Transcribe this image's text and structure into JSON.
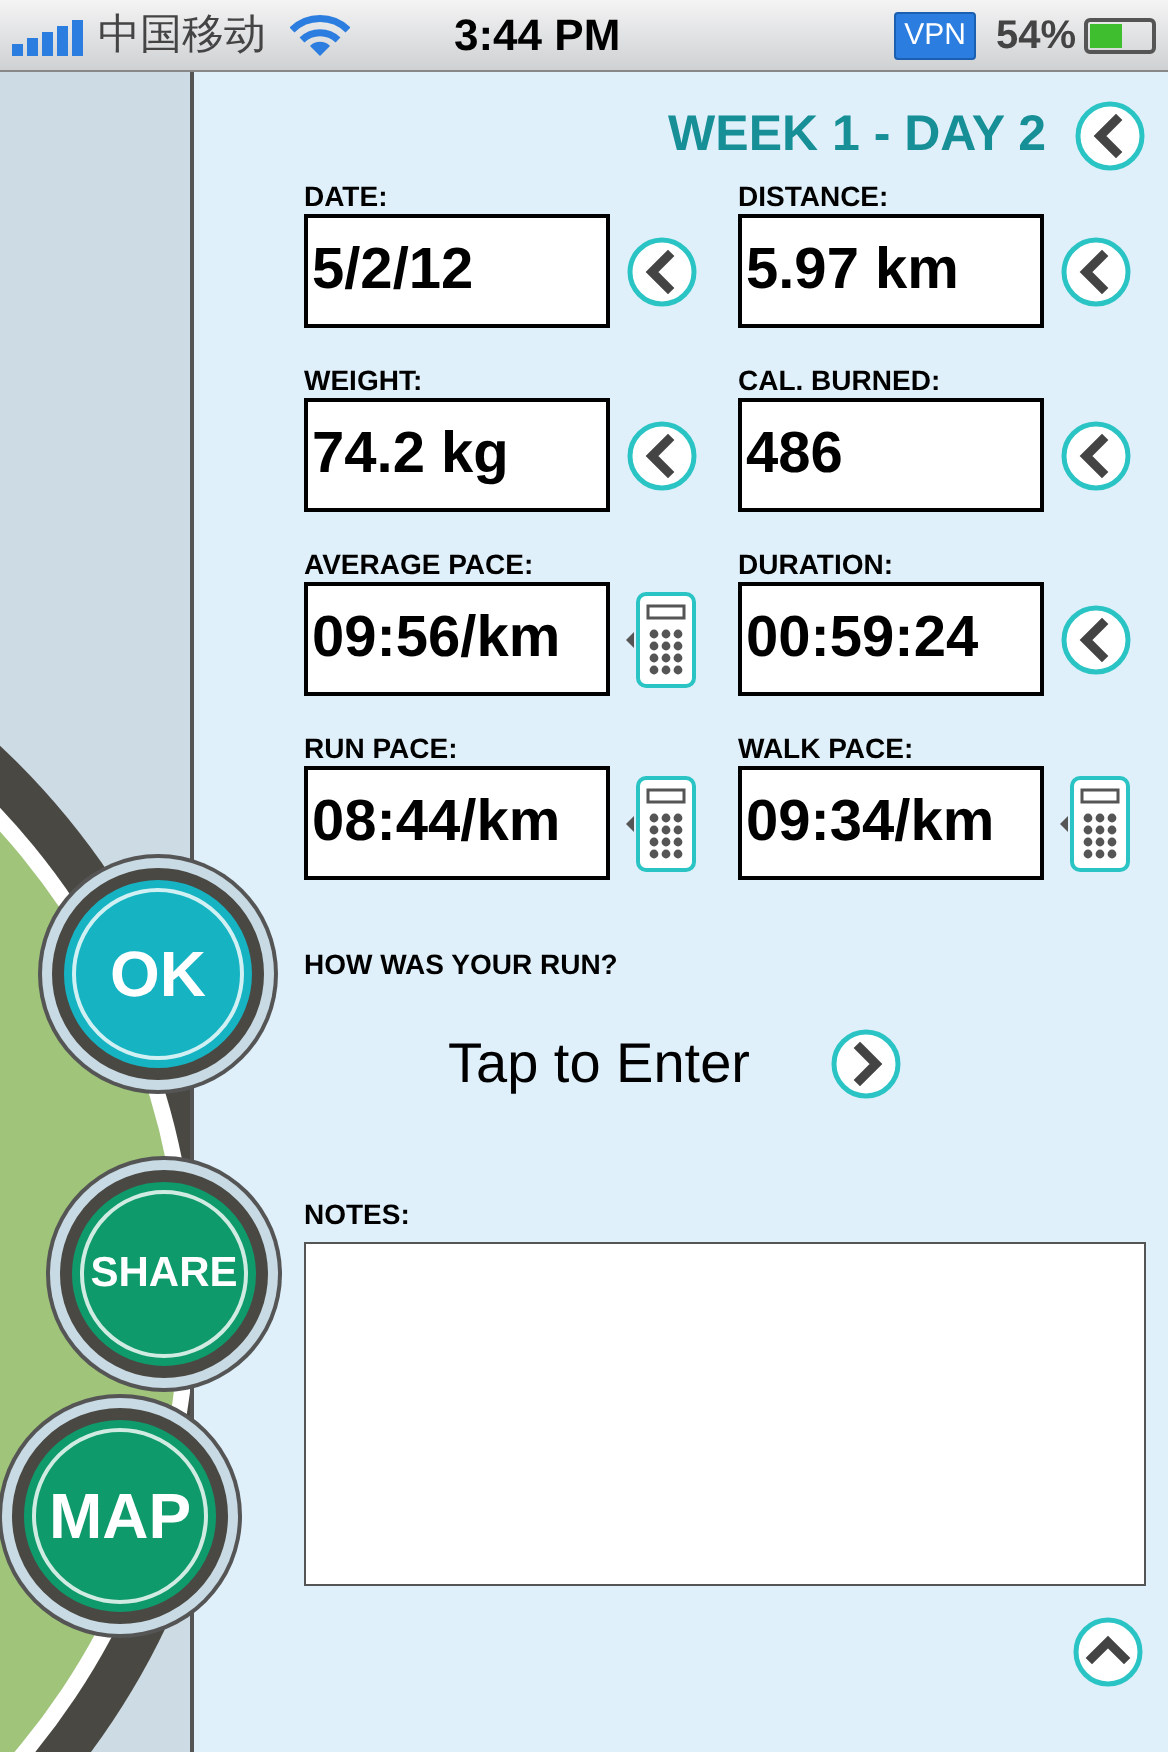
{
  "status_bar": {
    "carrier": "中国移动",
    "time": "3:44 PM",
    "vpn": "VPN",
    "battery": "54%"
  },
  "header": {
    "title": "WEEK 1 - DAY 2"
  },
  "fields": [
    {
      "label": "DATE:",
      "value": "5/2/12",
      "kind": "back"
    },
    {
      "label": "DISTANCE:",
      "value": "5.97 km",
      "kind": "back"
    },
    {
      "label": "WEIGHT:",
      "value": "74.2 kg",
      "kind": "back"
    },
    {
      "label": "CAL. BURNED:",
      "value": "486",
      "kind": "back"
    },
    {
      "label": "AVERAGE PACE:",
      "value": "09:56/km",
      "kind": "calculator"
    },
    {
      "label": "DURATION:",
      "value": "00:59:24",
      "kind": "back"
    },
    {
      "label": "RUN PACE:",
      "value": "08:44/km",
      "kind": "calculator"
    },
    {
      "label": "WALK PACE:",
      "value": "09:34/km",
      "kind": "calculator"
    }
  ],
  "run_rating": {
    "label": "HOW WAS YOUR RUN?",
    "value": "Tap to Enter"
  },
  "notes": {
    "label": "NOTES:"
  },
  "side_buttons": [
    {
      "label": "OK",
      "color": "#16b3c2"
    },
    {
      "label": "SHARE",
      "color": "#0f9a6c"
    },
    {
      "label": "MAP",
      "color": "#0f9a6c"
    }
  ]
}
